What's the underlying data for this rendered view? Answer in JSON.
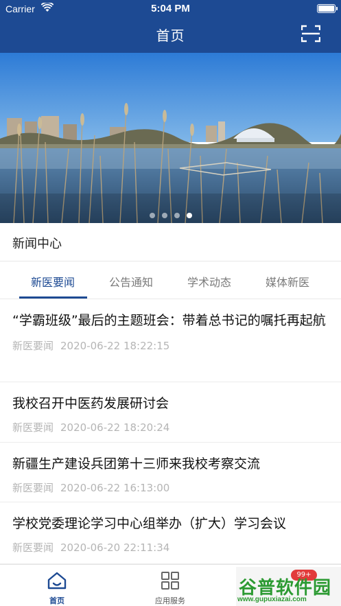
{
  "status_bar": {
    "carrier": "Carrier",
    "time": "5:04 PM"
  },
  "header": {
    "title": "首页",
    "scan_icon": "scan-icon"
  },
  "banner": {
    "slide_count": 4,
    "active_slide": 4
  },
  "news_section": {
    "title": "新闻中心",
    "tabs": [
      {
        "label": "新医要闻",
        "active": true
      },
      {
        "label": "公告通知",
        "active": false
      },
      {
        "label": "学术动态",
        "active": false
      },
      {
        "label": "媒体新医",
        "active": false
      }
    ],
    "items": [
      {
        "title": "“学霸班级”最后的主题班会：带着总书记的嘱托再起航",
        "category": "新医要闻",
        "datetime": "2020-06-22 18:22:15"
      },
      {
        "title": "我校召开中医药发展研讨会",
        "category": "新医要闻",
        "datetime": "2020-06-22 18:20:24"
      },
      {
        "title": "新疆生产建设兵团第十三师来我校考察交流",
        "category": "新医要闻",
        "datetime": "2020-06-22 16:13:00"
      },
      {
        "title": "学校党委理论学习中心组举办（扩大）学习会议",
        "category": "新医要闻",
        "datetime": "2020-06-20 22:11:34"
      }
    ]
  },
  "tabbar": {
    "items": [
      {
        "label": "首页",
        "icon": "home-icon",
        "active": true
      },
      {
        "label": "应用服务",
        "icon": "apps-grid-icon",
        "active": false
      }
    ]
  },
  "watermark": {
    "badge": "99+",
    "title": "谷普软件园",
    "url": "www.gupuxiazai.com"
  },
  "colors": {
    "primary": "#1d4a93",
    "watermark_green": "#2c9a32",
    "badge_red": "#e23b3b"
  }
}
